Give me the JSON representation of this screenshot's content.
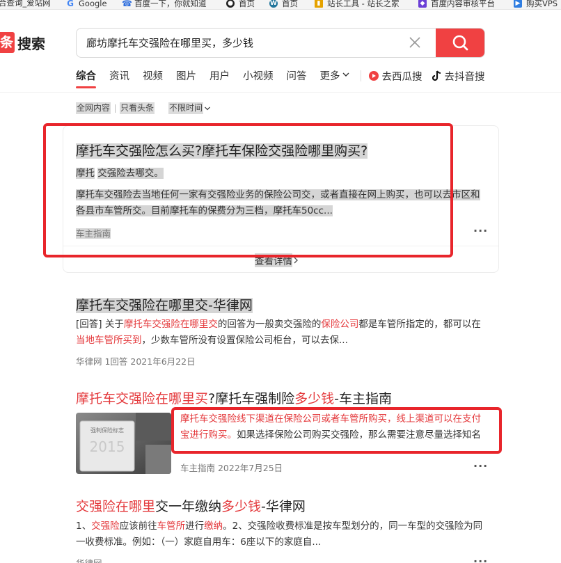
{
  "bookmarks": [
    {
      "label": "合查询_爱站网",
      "icon": "",
      "color": "#888888"
    },
    {
      "label": "Google",
      "icon": "G",
      "color": "#4285f4"
    },
    {
      "label": "百度一下，你就知道",
      "icon": "☎",
      "color": "#2f6fde"
    },
    {
      "label": "首页",
      "icon": "●",
      "color": "#222222"
    },
    {
      "label": "首页",
      "icon": "W",
      "color": "#21759b"
    },
    {
      "label": "站长工具 - 站长之家",
      "icon": "▮",
      "color": "#e5a200"
    },
    {
      "label": "百度内容审核平台",
      "icon": "◆",
      "color": "#6b3fd6"
    },
    {
      "label": "购买VPS",
      "icon": "▶",
      "color": "#2f7de1"
    }
  ],
  "logo": {
    "box": "条",
    "text": "搜索"
  },
  "search": {
    "value": "廊坊摩托车交强险在哪里买，多少钱"
  },
  "tabs": [
    "综合",
    "资讯",
    "视频",
    "图片",
    "用户",
    "小视频",
    "问答",
    "更多"
  ],
  "ext_links": [
    "去西瓜搜",
    "去抖音搜"
  ],
  "filters": [
    "全网内容",
    "只看头条",
    "不限时间"
  ],
  "featured": {
    "title": "摩托车交强险怎么买?摩托车保险交强险哪里购买?",
    "sub_a": "摩托",
    "sub_b": "交强险去哪交。",
    "snippet_a": "摩托车交强险去当地任何一家有交强险业务的保险公司交，或者",
    "snippet_b": "直接在网上购买，也可以去市区和各县市车管所交。目前",
    "snippet_c": "摩托车的保费分为三档，摩托车50cc...",
    "source": "车主指南",
    "view_more": "查看详情"
  },
  "result1": {
    "title": "摩托车交强险在哪里交-华律网",
    "s1": "[回答] 关于",
    "s2": "摩托车交强险在哪里交",
    "s3": "的回答为一般卖交强险的",
    "s4": "保险公司",
    "s5": "都是车管所指定的，都可以在",
    "s6": "当地车管所买到",
    "s7": "，少数车管所没有设置保险公司柜台，可以去保...",
    "meta": "华律网  1回答  2021年6月22日"
  },
  "result2": {
    "t1": "摩托车交强险在哪里买",
    "t2": "?摩托车强制险",
    "t3": "多少钱",
    "t4": "-车主指南",
    "s_red": "摩托车交强险线下渠道在保险公司或者车管所购买，线上渠道可以在支付宝进行购买。",
    "s_rest": "如果选择保险公司购买交强险，那么需要注意尽量选择知名度较高的",
    "meta": "车主指南  2022年7月25日",
    "thumb_text": "强制保险标志",
    "thumb_year": "2015"
  },
  "result3": {
    "t1": "交强险在哪里",
    "t2": "交一年缴纳",
    "t3": "多少钱",
    "t4": "-华律网",
    "s1": "1、",
    "s2": "交强险",
    "s3": "应该前往",
    "s4": "车管所",
    "s5": "进行",
    "s6": "缴纳",
    "s7": "。2、交强险收费标准是按车型划分的，同一车型的交强险为同一收费标准。例如：（一）家庭自用车：6座以下的家庭自...",
    "meta": "华律网"
  },
  "more_glyph": "···",
  "colors": {
    "accent": "#f04142",
    "link_red": "#e4393c",
    "annotation": "#e8252b"
  }
}
